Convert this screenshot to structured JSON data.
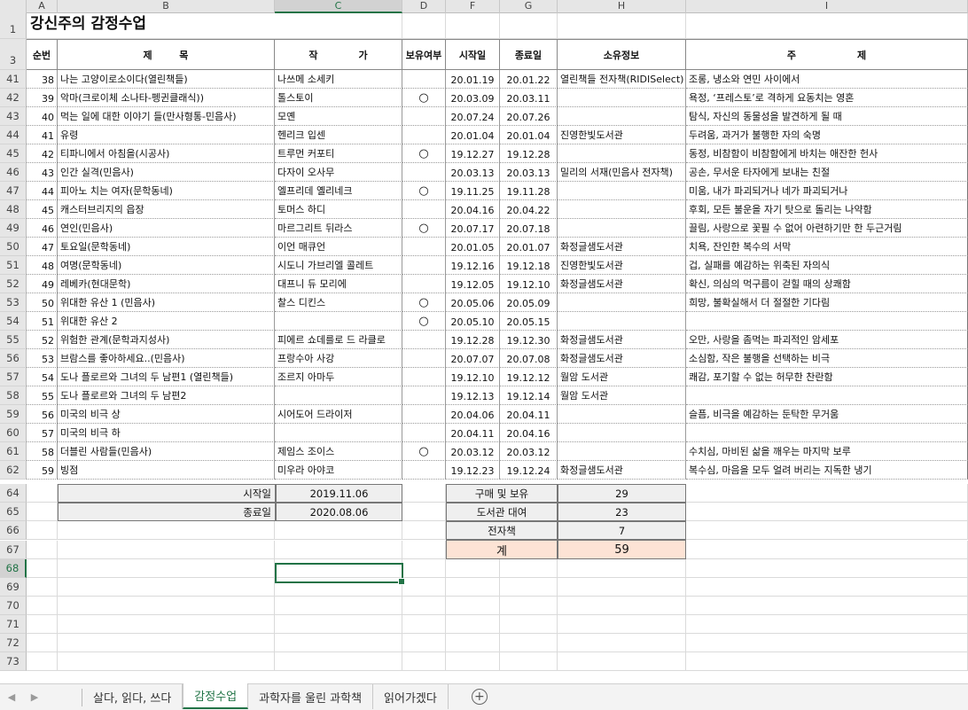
{
  "columns": [
    "A",
    "B",
    "C",
    "D",
    "F",
    "G",
    "H",
    "I"
  ],
  "selected_column": "C",
  "selected_row": "68",
  "title": "강신주의 감정수업",
  "header": {
    "num": "순번",
    "title": "제        목",
    "author": "작            가",
    "owned": "보유여부",
    "start": "시작일",
    "end": "종료일",
    "source": "소유정보",
    "theme": "주                  제"
  },
  "row_numbers": {
    "r1": "1",
    "r3": "3",
    "tail": [
      "64",
      "65",
      "66",
      "67",
      "68",
      "69",
      "70",
      "71",
      "72",
      "73"
    ]
  },
  "rows": [
    {
      "r": "41",
      "n": "38",
      "t": "나는 고양이로소이다(열린책들)",
      "a": "나쓰메 소세키",
      "o": "",
      "s": "20.01.19",
      "e": "20.01.22",
      "src": "열린책들 전자책(RIDISelect)",
      "th": "조롱, 냉소와 연민 사이에서"
    },
    {
      "r": "42",
      "n": "39",
      "t": "악마(크로이체 소나타-펭귄클래식))",
      "a": "톨스토이",
      "o": "○",
      "s": "20.03.09",
      "e": "20.03.11",
      "src": "",
      "th": "욕정, ‘프레스토’로 격하게 요동치는 영혼"
    },
    {
      "r": "43",
      "n": "40",
      "t": "먹는 일에 대한 이야기 들(만사형통-민음사)",
      "a": "모옌",
      "o": "",
      "s": "20.07.24",
      "e": "20.07.26",
      "src": "",
      "th": "탐식, 자신의 동물성을 발견하게 될 때"
    },
    {
      "r": "44",
      "n": "41",
      "t": "유령",
      "a": "헨리크 입센",
      "o": "",
      "s": "20.01.04",
      "e": "20.01.04",
      "src": "진영한빛도서관",
      "th": "두려움, 과거가 불행한 자의 숙명"
    },
    {
      "r": "45",
      "n": "42",
      "t": "티파니에서 아침을(시공사)",
      "a": "트루먼 커포티",
      "o": "○",
      "s": "19.12.27",
      "e": "19.12.28",
      "src": "",
      "th": "동정, 비참함이 비참함에게 바치는 애잔한 헌사"
    },
    {
      "r": "46",
      "n": "43",
      "t": "인간 실격(민음사)",
      "a": "다자이 오사무",
      "o": "",
      "s": "20.03.13",
      "e": "20.03.13",
      "src": "밀리의 서재(민음사 전자책)",
      "th": "공손, 무서운 타자에게 보내는 친절"
    },
    {
      "r": "47",
      "n": "44",
      "t": "피아노 치는 여자(문학동네)",
      "a": "엘프리데 옐리네크",
      "o": "○",
      "s": "19.11.25",
      "e": "19.11.28",
      "src": "",
      "th": "미움, 내가 파괴되거나 네가 파괴되거나"
    },
    {
      "r": "48",
      "n": "45",
      "t": "캐스터브리지의 읍장",
      "a": "토머스 하디",
      "o": "",
      "s": "20.04.16",
      "e": "20.04.22",
      "src": "",
      "th": "후회, 모든 불운을 자기 탓으로 돌리는 나약함"
    },
    {
      "r": "49",
      "n": "46",
      "t": "연인(민음사)",
      "a": "마르그리트 뒤라스",
      "o": "○",
      "s": "20.07.17",
      "e": "20.07.18",
      "src": "",
      "th": "끌림, 사랑으로 꽃필 수 없어 아련하기만 한 두근거림"
    },
    {
      "r": "50",
      "n": "47",
      "t": "토요일(문학동네)",
      "a": "이언 매큐언",
      "o": "",
      "s": "20.01.05",
      "e": "20.01.07",
      "src": "화정글샘도서관",
      "th": "치욕, 잔인한 복수의 서막"
    },
    {
      "r": "51",
      "n": "48",
      "t": "여명(문학동네)",
      "a": "시도니 가브리엘 콜레트",
      "o": "",
      "s": "19.12.16",
      "e": "19.12.18",
      "src": "진영한빛도서관",
      "th": "겁, 실패를 예감하는 위축된 자의식"
    },
    {
      "r": "52",
      "n": "49",
      "t": "레베카(현대문학)",
      "a": "대프니 듀 모리에",
      "o": "",
      "s": "19.12.05",
      "e": "19.12.10",
      "src": "화정글샘도서관",
      "th": "확신, 의심의 먹구름이 걷힐 때의 상쾌함"
    },
    {
      "r": "53",
      "n": "50",
      "t": "위대한 유산 1 (민음사)",
      "a": "찰스 디킨스",
      "o": "○",
      "s": "20.05.06",
      "e": "20.05.09",
      "src": "",
      "th": "희망, 불확실해서 더 절절한 기다림"
    },
    {
      "r": "54",
      "n": "51",
      "t": "위대한 유산 2",
      "a": "",
      "o": "○",
      "s": "20.05.10",
      "e": "20.05.15",
      "src": "",
      "th": ""
    },
    {
      "r": "55",
      "n": "52",
      "t": "위험한 관계(문학과지성사)",
      "a": "피에르 쇼데를로 드 라클로",
      "o": "",
      "s": "19.12.28",
      "e": "19.12.30",
      "src": "화정글샘도서관",
      "th": "오만, 사랑을 좀먹는 파괴적인 암세포"
    },
    {
      "r": "56",
      "n": "53",
      "t": "브람스를 좋아하세요..(민음사)",
      "a": "프랑수아 사강",
      "o": "",
      "s": "20.07.07",
      "e": "20.07.08",
      "src": "화정글샘도서관",
      "th": "소심함, 작은 불행을 선택하는 비극"
    },
    {
      "r": "57",
      "n": "54",
      "t": "도나 플로르와 그녀의 두 남편1 (열린책들)",
      "a": "조르지 아마두",
      "o": "",
      "s": "19.12.10",
      "e": "19.12.12",
      "src": "월암 도서관",
      "th": "쾌감, 포기할 수 없는 허무한 찬란함"
    },
    {
      "r": "58",
      "n": "55",
      "t": "도나 플로르와 그녀의 두 남편2",
      "a": "",
      "o": "",
      "s": "19.12.13",
      "e": "19.12.14",
      "src": "월암 도서관",
      "th": ""
    },
    {
      "r": "59",
      "n": "56",
      "t": "미국의 비극 상",
      "a": "시어도어 드라이저",
      "o": "",
      "s": "20.04.06",
      "e": "20.04.11",
      "src": "",
      "th": "슬픔, 비극을 예감하는 둔탁한 무거움"
    },
    {
      "r": "60",
      "n": "57",
      "t": "미국의 비극 하",
      "a": "",
      "o": "",
      "s": "20.04.11",
      "e": "20.04.16",
      "src": "",
      "th": ""
    },
    {
      "r": "61",
      "n": "58",
      "t": "더블린 사람들(민음사)",
      "a": "제임스 조이스",
      "o": "○",
      "s": "20.03.12",
      "e": "20.03.12",
      "src": "",
      "th": "수치심, 마비된 삶을 깨우는 마지막 보루"
    },
    {
      "r": "62",
      "n": "59",
      "t": "빙점",
      "a": "미우라 아야코",
      "o": "",
      "s": "19.12.23",
      "e": "19.12.24",
      "src": "화정글샘도서관",
      "th": "복수심, 마음을 모두 얼려 버리는 지독한 냉기"
    }
  ],
  "summary_dates": {
    "start_label": "시작일",
    "start_value": "2019.11.06",
    "end_label": "종료일",
    "end_value": "2020.08.06"
  },
  "summary_counts": [
    {
      "label": "구매 및 보유",
      "value": "29"
    },
    {
      "label": "도서관 대여",
      "value": "23"
    },
    {
      "label": "전자책",
      "value": "7"
    },
    {
      "label": "계",
      "value": "59"
    }
  ],
  "tabs": [
    "살다, 읽다, 쓰다",
    "감정수업",
    "과학자를 울린 과학책",
    "읽어가겠다"
  ],
  "active_tab": "감정수업",
  "colors": {
    "accent": "#217346",
    "total_fill": "#fde3d5",
    "box_fill": "#efefef"
  }
}
